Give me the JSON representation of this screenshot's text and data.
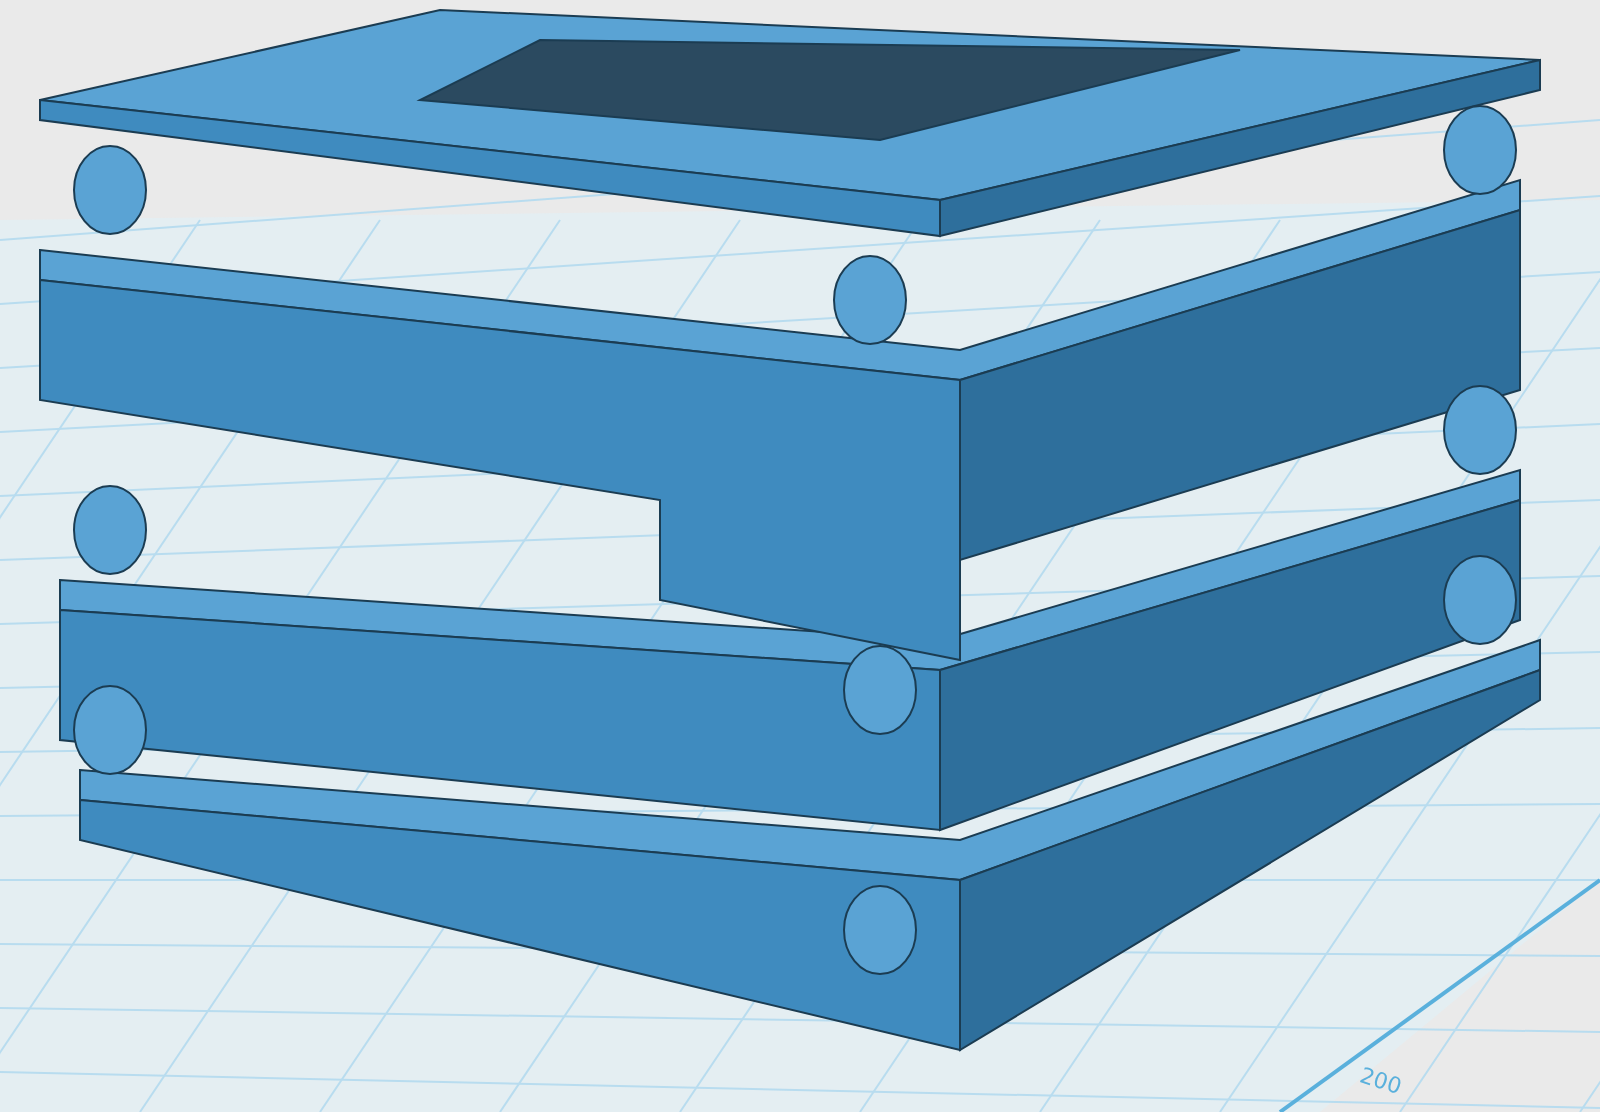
{
  "viewport": {
    "grid_label": "200"
  }
}
